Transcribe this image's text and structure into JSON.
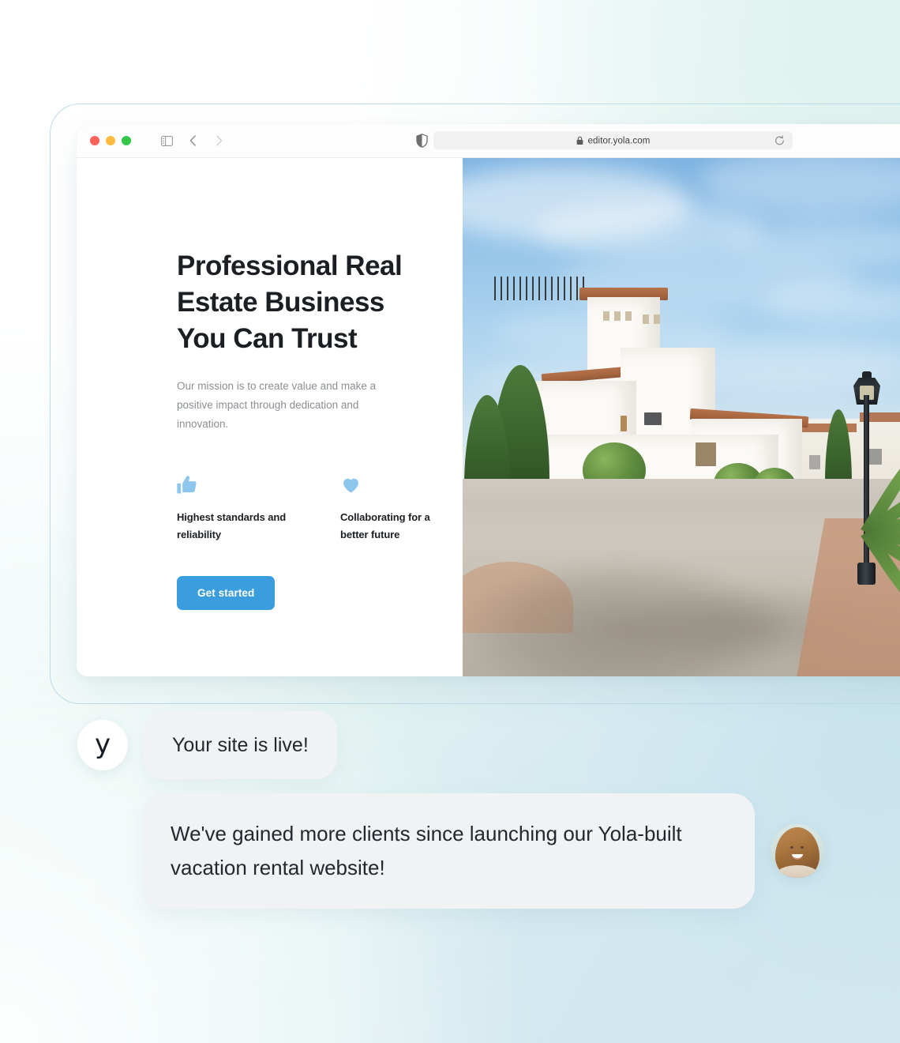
{
  "background": {
    "accent_mint": "#e0f2ee",
    "accent_blue": "#d3e8ee",
    "frame_border": "#bcdcea"
  },
  "browser": {
    "traffic_lights": [
      {
        "name": "close",
        "color": "#fc615c"
      },
      {
        "name": "minimize",
        "color": "#fdbc40"
      },
      {
        "name": "maximize",
        "color": "#34c749"
      }
    ],
    "sidebar_toggle_icon": "sidebar-toggle-icon",
    "back_icon": "chevron-left-icon",
    "forward_icon": "chevron-right-icon",
    "shield_icon": "privacy-shield-icon",
    "lock_icon": "lock-icon",
    "url": "editor.yola.com",
    "reload_icon": "reload-icon"
  },
  "site": {
    "hero": {
      "title": "Professional Real Estate Business You Can Trust",
      "subtitle": "Our mission is to create value and make a positive impact through dedication and innovation.",
      "cta_label": "Get started",
      "cta_color": "#3a9ddd",
      "icon_color": "#8ec7ee",
      "features": [
        {
          "icon": "thumbs-up-icon",
          "label": "Highest standards and reliability"
        },
        {
          "icon": "heart-icon",
          "label": "Collaborating for a better future"
        }
      ],
      "photo_alt": "White Mediterranean villas with terracotta roofs along a paved street with a lamp post"
    }
  },
  "chat": {
    "messages": [
      {
        "avatar": "yola-logo-avatar",
        "avatar_letter": "y",
        "text": "Your site is live!"
      },
      {
        "avatar": "customer-photo-avatar",
        "text": "We've gained more clients since launching our Yola-built vacation rental website!"
      }
    ]
  }
}
